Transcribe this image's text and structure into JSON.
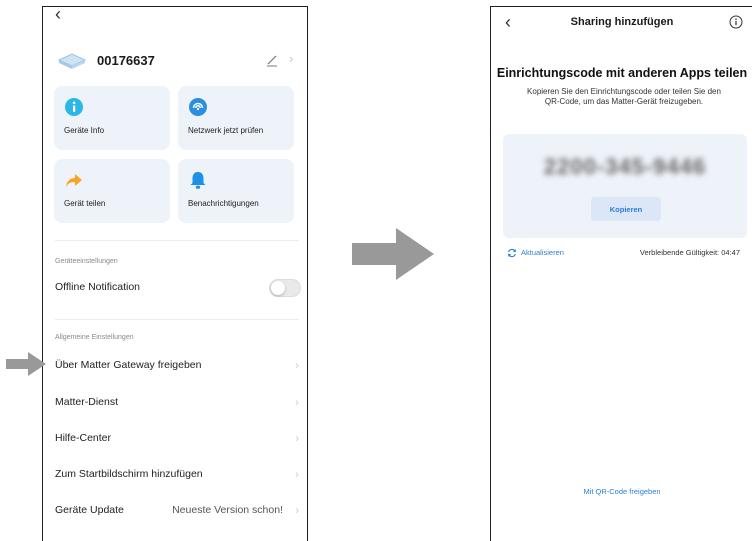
{
  "left_screen": {
    "device": {
      "name": "00176637"
    },
    "tiles": [
      {
        "label": "Geräte Info",
        "icon": "info-icon"
      },
      {
        "label": "Netzwerk jetzt prüfen",
        "icon": "network-icon"
      },
      {
        "label": "Gerät teilen",
        "icon": "share-icon"
      },
      {
        "label": "Benachrichtigungen",
        "icon": "bell-icon"
      }
    ],
    "device_settings": {
      "header": "Geräteeinstellungen",
      "offline_notification": {
        "label": "Offline Notification",
        "enabled": false
      }
    },
    "general_settings": {
      "header": "Allgemeine Einstellungen",
      "items": [
        {
          "label": "Über Matter Gateway freigeben"
        },
        {
          "label": "Matter-Dienst"
        },
        {
          "label": "Hilfe-Center"
        },
        {
          "label": "Zum Startbildschirm hinzufügen"
        },
        {
          "label": "Geräte Update",
          "value": "Neueste Version schon!"
        }
      ]
    }
  },
  "right_screen": {
    "title": "Sharing hinzufügen",
    "heading": "Einrichtungscode mit anderen Apps teilen",
    "description": "Kopieren Sie den Einrichtungscode oder teilen Sie den QR-Code, um das Matter-Gerät freizugeben.",
    "setup_code": "2200-345-9446",
    "copy_label": "Kopieren",
    "refresh_label": "Aktualisieren",
    "validity_text": "Verbleibende Gültigkeit: 04:47",
    "qr_share_label": "Mit QR-Code freigeben"
  },
  "colors": {
    "accent_blue": "#2c7fd6",
    "info_icon": "#2bb8e8",
    "network_icon": "#2b8fe0",
    "share_icon": "#f5a623",
    "bell_icon": "#1e90e8",
    "tile_bg": "#eef2f9",
    "arrow_gray": "#999999"
  }
}
